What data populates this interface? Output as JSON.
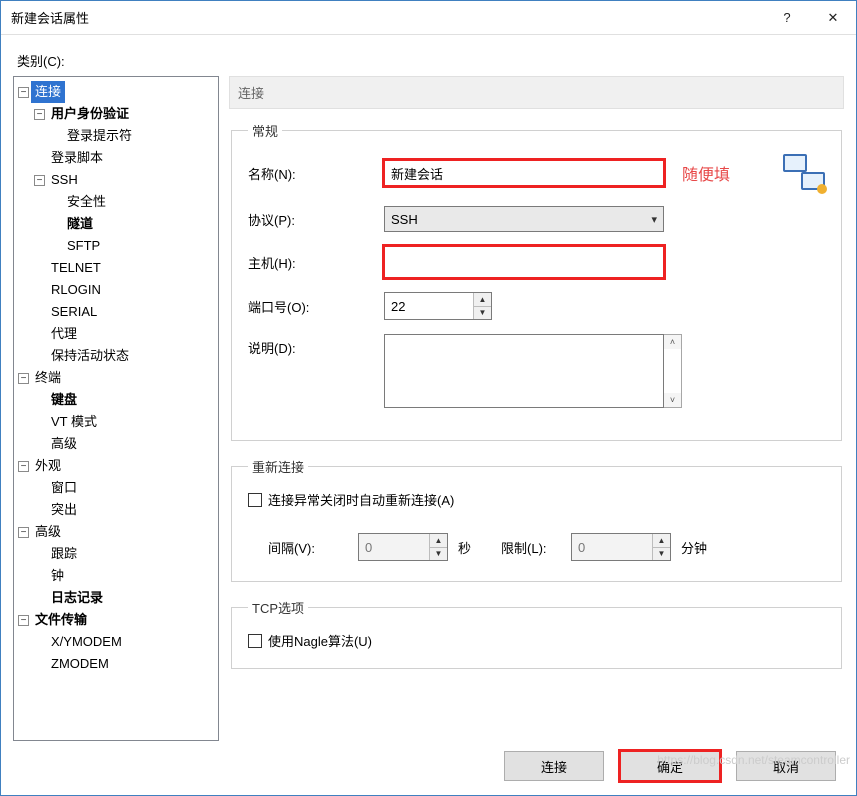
{
  "window": {
    "title": "新建会话属性",
    "help_label": "?",
    "close_label": "✕"
  },
  "categories_label": "类别(C):",
  "tree": {
    "connection": "连接",
    "user_auth": "用户身份验证",
    "login_prompt": "登录提示符",
    "login_script": "登录脚本",
    "ssh": "SSH",
    "security": "安全性",
    "tunnel": "隧道",
    "sftp": "SFTP",
    "telnet": "TELNET",
    "rlogin": "RLOGIN",
    "serial": "SERIAL",
    "proxy": "代理",
    "keepalive": "保持活动状态",
    "terminal": "终端",
    "keyboard": "键盘",
    "vt_mode": "VT 模式",
    "advanced_term": "高级",
    "appearance": "外观",
    "window": "窗口",
    "highlight": "突出",
    "advanced": "高级",
    "trace": "跟踪",
    "bell": "钟",
    "logging": "日志记录",
    "file_transfer": "文件传输",
    "xymodem": "X/YMODEM",
    "zmodem": "ZMODEM"
  },
  "section_title": "连接",
  "general": {
    "legend": "常规",
    "name_label": "名称(N):",
    "name_value": "新建会话",
    "name_hint": "随便填",
    "protocol_label": "协议(P):",
    "protocol_value": "SSH",
    "host_label": "主机(H):",
    "host_value": "",
    "port_label": "端口号(O):",
    "port_value": "22",
    "desc_label": "说明(D):",
    "desc_value": ""
  },
  "reconnect": {
    "legend": "重新连接",
    "auto_label": "连接异常关闭时自动重新连接(A)",
    "interval_label": "间隔(V):",
    "interval_value": "0",
    "interval_unit": "秒",
    "limit_label": "限制(L):",
    "limit_value": "0",
    "limit_unit": "分钟"
  },
  "tcp": {
    "legend": "TCP选项",
    "nagle_label": "使用Nagle算法(U)"
  },
  "buttons": {
    "connect": "连接",
    "ok": "确定",
    "cancel": "取消"
  },
  "watermark": "https://blog.csdn.net/steamcontroller"
}
